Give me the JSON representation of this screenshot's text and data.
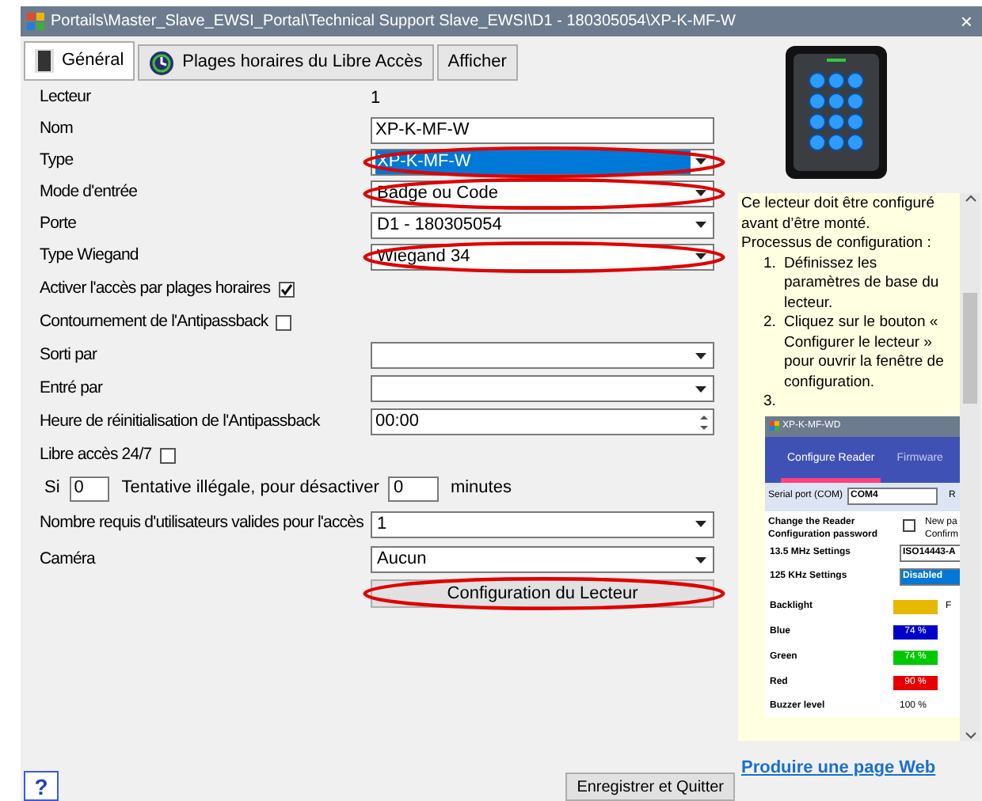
{
  "window": {
    "title": "Portails\\Master_Slave_EWSI_Portal\\Technical Support Slave_EWSI\\D1 - 180305054\\XP-K-MF-W",
    "close": "×"
  },
  "tabs": [
    {
      "label": "Général",
      "selected": true
    },
    {
      "label": "Plages horaires du Libre Accès",
      "selected": false
    },
    {
      "label": "Afficher",
      "selected": false
    }
  ],
  "form": [
    {
      "kind": "readonly",
      "label": "Lecteur",
      "value": "1"
    },
    {
      "kind": "text",
      "label": "Nom",
      "value": "XP-K-MF-W",
      "highlighted": false
    },
    {
      "kind": "dropdown",
      "label": "Type",
      "value": "XP-K-MF-W",
      "focused": true,
      "highlighted": true
    },
    {
      "kind": "dropdown",
      "label": "Mode d'entrée",
      "value": "Badge ou Code",
      "focused": false,
      "highlighted": true
    },
    {
      "kind": "dropdown",
      "label": "Porte",
      "value": "D1 - 180305054",
      "focused": false,
      "highlighted": false
    },
    {
      "kind": "dropdown",
      "label": "Type Wiegand",
      "value": "Wiegand 34",
      "focused": false,
      "highlighted": true
    },
    {
      "kind": "checkbox",
      "label": "Activer l'accès par plages horaires",
      "checked": true
    },
    {
      "kind": "checkbox",
      "label": "Contournement de l'Antipassback",
      "checked": false
    },
    {
      "kind": "dropdown",
      "label": "Sorti par",
      "focused": false,
      "highlighted": false
    },
    {
      "kind": "dropdown",
      "label": "Entré par",
      "focused": false,
      "highlighted": false
    },
    {
      "kind": "spinner",
      "label": "Heure de réinitialisation de l'Antipassback",
      "value": "00:00"
    },
    {
      "kind": "checkbox",
      "label": "Libre accès 24/7",
      "checked": false
    },
    {
      "kind": "attempts",
      "prefix": "Si",
      "count": "0",
      "label": "Tentative illégale, pour désactiver",
      "minutes": "0",
      "suffix": "minutes"
    },
    {
      "kind": "dropdown",
      "label": "Nombre requis d'utilisateurs valides pour l'accès",
      "value": "1",
      "focused": false,
      "highlighted": false
    },
    {
      "kind": "dropdown",
      "label": "Caméra",
      "value": "Aucun",
      "focused": false,
      "highlighted": false
    }
  ],
  "config_button": {
    "label": "Configuration du Lecteur",
    "highlighted": true
  },
  "help_panel": {
    "intro": [
      "Ce lecteur doit être configuré avant d’être monté.",
      "Processus de configuration :"
    ],
    "steps": [
      {
        "number": "1.",
        "text": "Définissez les paramètres de base du lecteur."
      },
      {
        "number": "2.",
        "text": "Cliquez sur le bouton « Configurer le lecteur » pour ouvrir la fenêtre de configuration."
      },
      {
        "number": "3."
      }
    ],
    "screenshot": {
      "title": "XP-K-MF-WD",
      "tabs": [
        {
          "label": "Configure Reader",
          "selected": true
        },
        {
          "label": "Firmware",
          "selected": false
        }
      ],
      "serial_label": "Serial port (COM)",
      "serial_value": "COM4",
      "serial_extra": "R",
      "password_label": "Change the Reader Configuration password",
      "password_checked": false,
      "new_password": "New pa",
      "confirm": "Confirm",
      "settings": [
        {
          "label": "13.5 MHz Settings",
          "value": "ISO14443-A",
          "selected": false
        },
        {
          "label": "125 KHz Settings",
          "value": "Disabled",
          "selected": true
        }
      ],
      "leds": [
        {
          "label": "Backlight",
          "color": "#e6b800",
          "extra": "F"
        },
        {
          "label": "Blue",
          "color": "#0000c8",
          "value": "74 %"
        },
        {
          "label": "Green",
          "color": "#00c800",
          "value": "74 %"
        },
        {
          "label": "Red",
          "color": "#e60000",
          "value": "90 %"
        }
      ],
      "buzzer": {
        "label": "Buzzer level",
        "value": "100 %"
      }
    }
  },
  "link": "Produire une page Web",
  "help_button": "?",
  "save_button": "Enregistrer et Quitter"
}
